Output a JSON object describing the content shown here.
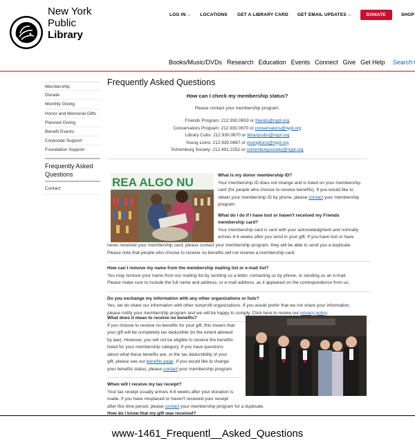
{
  "header": {
    "logo_line1": "New York",
    "logo_line2": "Public",
    "logo_line3": "Library",
    "utility": {
      "login": "LOG IN",
      "locations": "LOCATIONS",
      "library_card": "GET A LIBRARY CARD",
      "email_updates": "GET EMAIL UPDATES",
      "donate": "DONATE",
      "shop": "SHOP"
    },
    "main_nav": [
      "Books/Music/DVDs",
      "Research",
      "Education",
      "Events",
      "Connect",
      "Give",
      "Get Help"
    ],
    "search_label": "Search"
  },
  "sidebar": {
    "items": [
      "Membership",
      "Donate",
      "Monthly Giving",
      "Honor and Memorial Gifts",
      "Planned Giving",
      "Benefit Events",
      "Corporate Support",
      "Foundation Support"
    ],
    "active": "Frequently Asked Questions",
    "contact": "Contact"
  },
  "page": {
    "title": "Frequently Asked Questions",
    "check_heading": "How can I check my membership status?",
    "contact_intro": "Please contact your membership program:",
    "programs": [
      {
        "label": "Friends Program: 212.930.0653 or ",
        "email": "friends@nypl.org"
      },
      {
        "label": "Conservators Program: 212.930.0670 or ",
        "email": "conservators@nypl.org"
      },
      {
        "label": "Library Cubs: 212.930.0670 or ",
        "email": "librarycubs@nypl.org"
      },
      {
        "label": "Young Lions: 212.930.0887 or ",
        "email": "younglions@nypl.org"
      },
      {
        "label": "Schomburg Society: 212.491.2252 or ",
        "email": "schomburgsociety@nypl.org"
      }
    ],
    "photo1_sign": "REA ALGO NU",
    "q1": "What is my donor membership ID?",
    "a1_l1": "Your membership ID does not change and is listed on your membership",
    "a1_l2": "card (for people who choose to receive benefits). If you would like to",
    "a1_l3_pre": "obtain your membership ID by phone, please ",
    "a1_link": "contact",
    "a1_l3_post": " your membership",
    "a1_l4": "program.",
    "q2_l1": "What do I do if I have lost or haven't received my Friends",
    "q2_l2": "membership card?",
    "a2_l1": "Your membership card is sent with your acknowledgment and normally",
    "a2_l2": "arrives 4-6 weeks after you send in your gift. If you have lost or have",
    "a2_l3": "never received your membership card, please contact your membership program; they will be able to send you a duplicate.",
    "a2_l4": "Please note that people who choose to receive no benefits will not receive a membership card.",
    "q3": "How can I remove my name from the membership mailing list or e-mail list?",
    "a3_l1": "You may remove your name from our mailing list by sending us a letter, contacting us by phone, or sending us an e-mail.",
    "a3_l2": "Please make sure to include the full name and address, or e-mail address, as it appeared on the correspondence from us.",
    "q4": "Do you exchange my information with any other organizations or lists?",
    "a4_l1": "Yes, we do share our information with other nonprofit organizations. If you would prefer that we not share your information,",
    "a4_l2_pre": "please notify your membership program and we will be happy to comply. Click here to review our ",
    "a4_link": "privacy policy",
    "a4_l2_post": ".",
    "q5": "What does it mean to receive no benefits?",
    "a5_l1": "If you choose to receive no benefits for your gift, this means that",
    "a5_l2": "your gift will be completely tax deductible (to the extent allowed",
    "a5_l3": "by law). However, you will not be eligible to receive the benefits",
    "a5_l4": "listed for your membership category. If you have questions",
    "a5_l5": "about what these benefits are, or the tax deductibility of your",
    "a5_l6_pre": "gift, please see our ",
    "a5_link1": "benefits page",
    "a5_l6_post": ".  If you would like to change",
    "a5_l7_pre": "your benefits status, please ",
    "a5_link2": "contact",
    "a5_l7_post": " your membership program.",
    "q6": "When will I receive my tax receipt?",
    "a6_l1": "Your tax receipt usually arrives 4-6 weeks after your donation is",
    "a6_l2": "made. If you have misplaced or haven't received your receipt",
    "a6_l3_pre": "after this time period, please ",
    "a6_link": "contact",
    "a6_l3_post": " your membership program for a duplicate.",
    "q7_cut": "How do I know that my gift was received?"
  },
  "caption": "www-1461_Frequentl__Asked_Questions",
  "colors": {
    "accent_red": "#c8102e",
    "link_blue": "#1b5fa8",
    "rule_pink": "#e87c82"
  }
}
